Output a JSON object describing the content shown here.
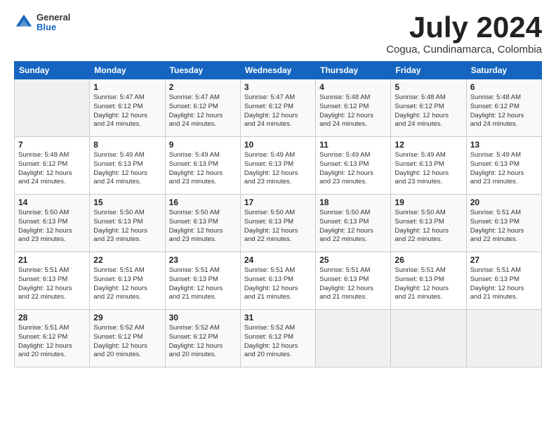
{
  "logo": {
    "general": "General",
    "blue": "Blue"
  },
  "header": {
    "month_year": "July 2024",
    "location": "Cogua, Cundinamarca, Colombia"
  },
  "days_of_week": [
    "Sunday",
    "Monday",
    "Tuesday",
    "Wednesday",
    "Thursday",
    "Friday",
    "Saturday"
  ],
  "weeks": [
    [
      {
        "day": "",
        "info": ""
      },
      {
        "day": "1",
        "info": "Sunrise: 5:47 AM\nSunset: 6:12 PM\nDaylight: 12 hours\nand 24 minutes."
      },
      {
        "day": "2",
        "info": "Sunrise: 5:47 AM\nSunset: 6:12 PM\nDaylight: 12 hours\nand 24 minutes."
      },
      {
        "day": "3",
        "info": "Sunrise: 5:47 AM\nSunset: 6:12 PM\nDaylight: 12 hours\nand 24 minutes."
      },
      {
        "day": "4",
        "info": "Sunrise: 5:48 AM\nSunset: 6:12 PM\nDaylight: 12 hours\nand 24 minutes."
      },
      {
        "day": "5",
        "info": "Sunrise: 5:48 AM\nSunset: 6:12 PM\nDaylight: 12 hours\nand 24 minutes."
      },
      {
        "day": "6",
        "info": "Sunrise: 5:48 AM\nSunset: 6:12 PM\nDaylight: 12 hours\nand 24 minutes."
      }
    ],
    [
      {
        "day": "7",
        "info": "Sunrise: 5:48 AM\nSunset: 6:12 PM\nDaylight: 12 hours\nand 24 minutes."
      },
      {
        "day": "8",
        "info": "Sunrise: 5:49 AM\nSunset: 6:13 PM\nDaylight: 12 hours\nand 24 minutes."
      },
      {
        "day": "9",
        "info": "Sunrise: 5:49 AM\nSunset: 6:13 PM\nDaylight: 12 hours\nand 23 minutes."
      },
      {
        "day": "10",
        "info": "Sunrise: 5:49 AM\nSunset: 6:13 PM\nDaylight: 12 hours\nand 23 minutes."
      },
      {
        "day": "11",
        "info": "Sunrise: 5:49 AM\nSunset: 6:13 PM\nDaylight: 12 hours\nand 23 minutes."
      },
      {
        "day": "12",
        "info": "Sunrise: 5:49 AM\nSunset: 6:13 PM\nDaylight: 12 hours\nand 23 minutes."
      },
      {
        "day": "13",
        "info": "Sunrise: 5:49 AM\nSunset: 6:13 PM\nDaylight: 12 hours\nand 23 minutes."
      }
    ],
    [
      {
        "day": "14",
        "info": "Sunrise: 5:50 AM\nSunset: 6:13 PM\nDaylight: 12 hours\nand 23 minutes."
      },
      {
        "day": "15",
        "info": "Sunrise: 5:50 AM\nSunset: 6:13 PM\nDaylight: 12 hours\nand 23 minutes."
      },
      {
        "day": "16",
        "info": "Sunrise: 5:50 AM\nSunset: 6:13 PM\nDaylight: 12 hours\nand 23 minutes."
      },
      {
        "day": "17",
        "info": "Sunrise: 5:50 AM\nSunset: 6:13 PM\nDaylight: 12 hours\nand 22 minutes."
      },
      {
        "day": "18",
        "info": "Sunrise: 5:50 AM\nSunset: 6:13 PM\nDaylight: 12 hours\nand 22 minutes."
      },
      {
        "day": "19",
        "info": "Sunrise: 5:50 AM\nSunset: 6:13 PM\nDaylight: 12 hours\nand 22 minutes."
      },
      {
        "day": "20",
        "info": "Sunrise: 5:51 AM\nSunset: 6:13 PM\nDaylight: 12 hours\nand 22 minutes."
      }
    ],
    [
      {
        "day": "21",
        "info": "Sunrise: 5:51 AM\nSunset: 6:13 PM\nDaylight: 12 hours\nand 22 minutes."
      },
      {
        "day": "22",
        "info": "Sunrise: 5:51 AM\nSunset: 6:13 PM\nDaylight: 12 hours\nand 22 minutes."
      },
      {
        "day": "23",
        "info": "Sunrise: 5:51 AM\nSunset: 6:13 PM\nDaylight: 12 hours\nand 21 minutes."
      },
      {
        "day": "24",
        "info": "Sunrise: 5:51 AM\nSunset: 6:13 PM\nDaylight: 12 hours\nand 21 minutes."
      },
      {
        "day": "25",
        "info": "Sunrise: 5:51 AM\nSunset: 6:13 PM\nDaylight: 12 hours\nand 21 minutes."
      },
      {
        "day": "26",
        "info": "Sunrise: 5:51 AM\nSunset: 6:13 PM\nDaylight: 12 hours\nand 21 minutes."
      },
      {
        "day": "27",
        "info": "Sunrise: 5:51 AM\nSunset: 6:13 PM\nDaylight: 12 hours\nand 21 minutes."
      }
    ],
    [
      {
        "day": "28",
        "info": "Sunrise: 5:51 AM\nSunset: 6:12 PM\nDaylight: 12 hours\nand 20 minutes."
      },
      {
        "day": "29",
        "info": "Sunrise: 5:52 AM\nSunset: 6:12 PM\nDaylight: 12 hours\nand 20 minutes."
      },
      {
        "day": "30",
        "info": "Sunrise: 5:52 AM\nSunset: 6:12 PM\nDaylight: 12 hours\nand 20 minutes."
      },
      {
        "day": "31",
        "info": "Sunrise: 5:52 AM\nSunset: 6:12 PM\nDaylight: 12 hours\nand 20 minutes."
      },
      {
        "day": "",
        "info": ""
      },
      {
        "day": "",
        "info": ""
      },
      {
        "day": "",
        "info": ""
      }
    ]
  ]
}
